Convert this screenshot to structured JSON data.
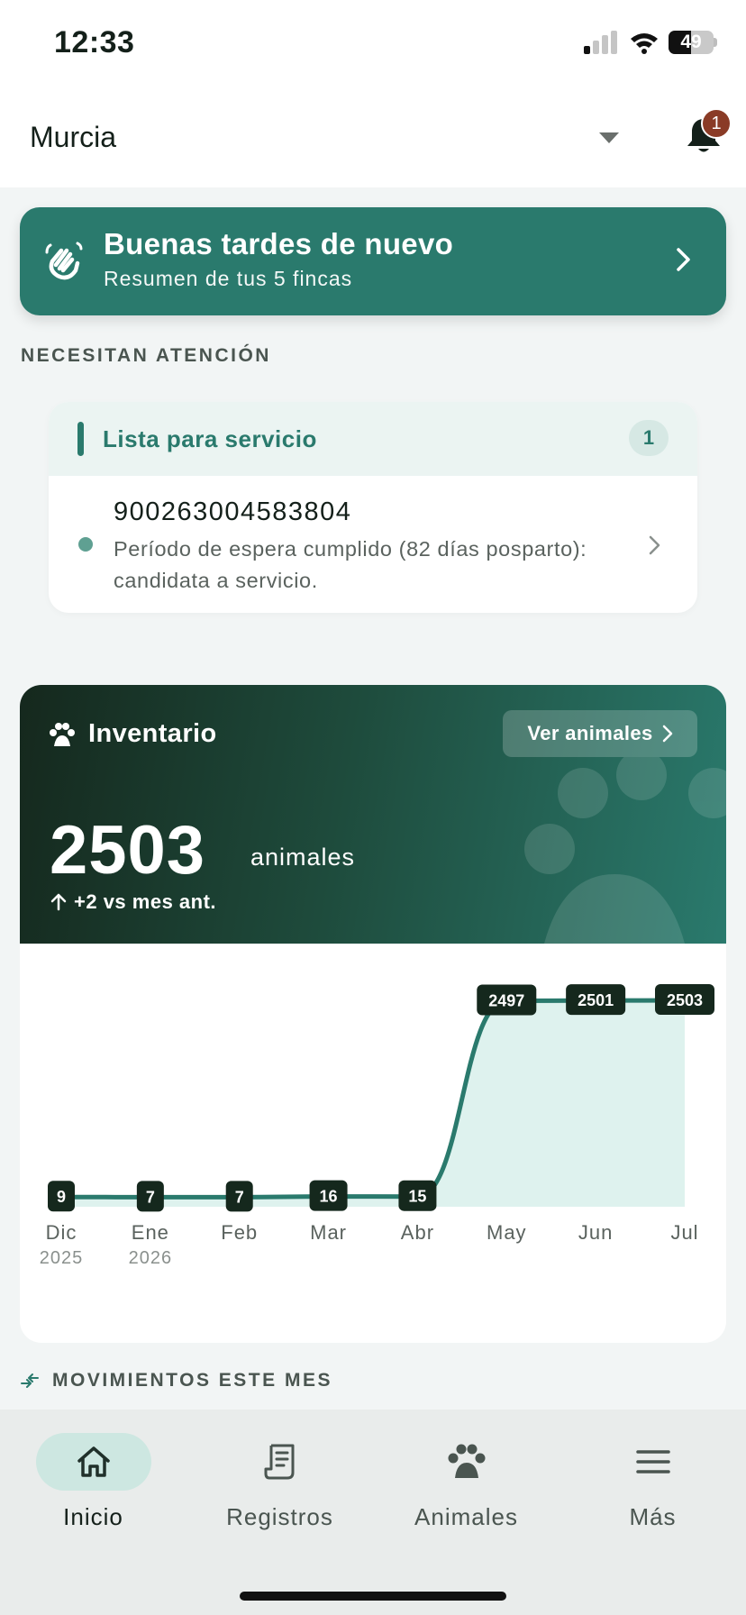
{
  "status_bar": {
    "time": "12:33",
    "battery": "49",
    "battery_level": 0.49
  },
  "header": {
    "location": "Murcia",
    "notifications_count": "1",
    "icons": {
      "dropdown": "chevron-down-icon",
      "bell": "bell-icon"
    }
  },
  "greeting": {
    "title": "Buenas tardes de nuevo",
    "subtitle": "Resumen de tus 5 fincas",
    "icon": "waving-hand-icon"
  },
  "attention": {
    "section_label": "NECESITAN ATENCIÓN",
    "group_title": "Lista para servicio",
    "group_count": "1",
    "items": [
      {
        "id": "900263004583804",
        "description": "Período de espera cumplido (82 días posparto): candidata a servicio."
      }
    ]
  },
  "inventory": {
    "title": "Inventario",
    "view_button": "Ver animales",
    "count": "2503",
    "unit": "animales",
    "delta": "+2 vs mes ant.",
    "colors": {
      "accent": "#2a7a6d",
      "dark": "#15281d",
      "area_fill": "#def2ee"
    }
  },
  "chart_data": {
    "type": "area",
    "categories": [
      "Dic",
      "Ene",
      "Feb",
      "Mar",
      "Abr",
      "May",
      "Jun",
      "Jul"
    ],
    "category_years": [
      "2025",
      "2026",
      "",
      "",
      "",
      "",
      "",
      ""
    ],
    "series": [
      {
        "values": [
          9,
          7,
          7,
          16,
          15,
          2497,
          2501,
          2503
        ]
      }
    ],
    "data_labels": [
      "9",
      "7",
      "7",
      "16",
      "15",
      "2497",
      "2501",
      "2503"
    ],
    "grid": false,
    "ylim": [
      0,
      2503
    ]
  },
  "movements": {
    "section_label": "MOVIMIENTOS ESTE MES"
  },
  "nav": {
    "items": [
      {
        "label": "Inicio",
        "icon": "home-icon",
        "active": true
      },
      {
        "label": "Registros",
        "icon": "receipt-icon",
        "active": false
      },
      {
        "label": "Animales",
        "icon": "paw-icon",
        "active": false
      },
      {
        "label": "Más",
        "icon": "menu-icon",
        "active": false
      }
    ]
  }
}
